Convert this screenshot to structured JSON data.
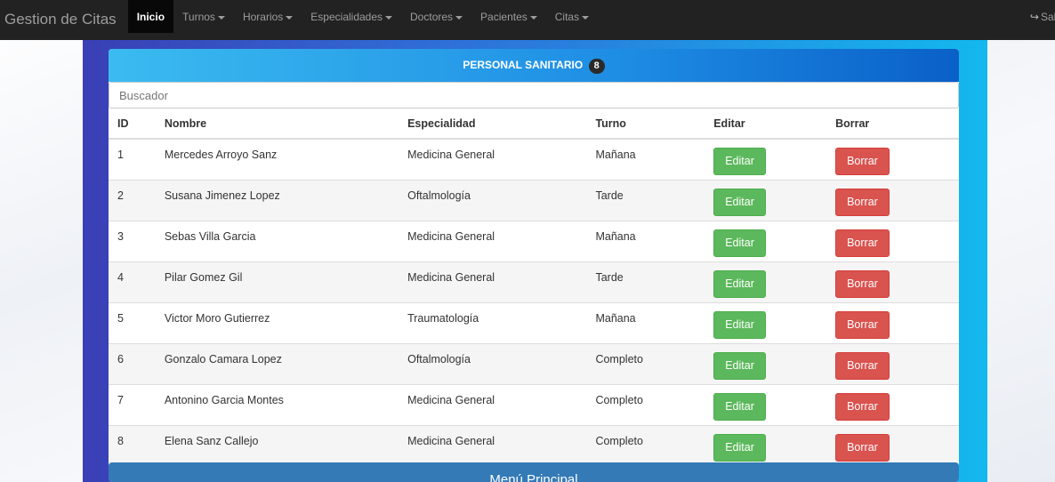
{
  "navbar": {
    "brand": "Gestion de Citas",
    "items": [
      {
        "label": "Inicio",
        "active": true,
        "dropdown": false
      },
      {
        "label": "Turnos",
        "dropdown": true
      },
      {
        "label": "Horarios",
        "dropdown": true
      },
      {
        "label": "Especialidades",
        "dropdown": true
      },
      {
        "label": "Doctores",
        "dropdown": true
      },
      {
        "label": "Pacientes",
        "dropdown": true
      },
      {
        "label": "Citas",
        "dropdown": true
      }
    ],
    "logout_label": "Sali",
    "logout_icon": "log-out-icon"
  },
  "panel": {
    "title": "PERSONAL SANITARIO",
    "count": "8",
    "search_placeholder": "Buscador",
    "columns": [
      "ID",
      "Nombre",
      "Especialidad",
      "Turno",
      "Editar",
      "Borrar"
    ],
    "rows": [
      {
        "id": "1",
        "nombre": "Mercedes Arroyo Sanz",
        "especialidad": "Medicina General",
        "turno": "Mañana"
      },
      {
        "id": "2",
        "nombre": "Susana Jimenez Lopez",
        "especialidad": "Oftalmología",
        "turno": "Tarde"
      },
      {
        "id": "3",
        "nombre": "Sebas Villa Garcia",
        "especialidad": "Medicina General",
        "turno": "Mañana"
      },
      {
        "id": "4",
        "nombre": "Pilar Gomez Gil",
        "especialidad": "Medicina General",
        "turno": "Tarde"
      },
      {
        "id": "5",
        "nombre": "Victor Moro Gutierrez",
        "especialidad": "Traumatología",
        "turno": "Mañana"
      },
      {
        "id": "6",
        "nombre": "Gonzalo Camara Lopez",
        "especialidad": "Oftalmología",
        "turno": "Completo"
      },
      {
        "id": "7",
        "nombre": "Antonino Garcia Montes",
        "especialidad": "Medicina General",
        "turno": "Completo"
      },
      {
        "id": "8",
        "nombre": "Elena Sanz Callejo",
        "especialidad": "Medicina General",
        "turno": "Completo"
      }
    ],
    "edit_label": "Editar",
    "delete_label": "Borrar",
    "footer_label": "Menú Principal"
  },
  "colors": {
    "navbar": "#222222",
    "edit": "#5cb85c",
    "delete": "#d9534f",
    "footer": "#337ab7"
  }
}
